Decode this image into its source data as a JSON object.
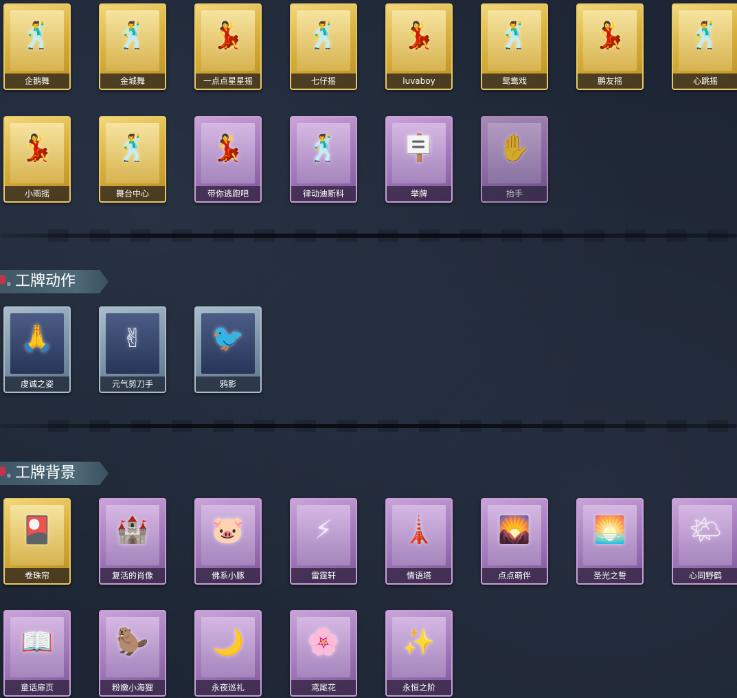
{
  "dance_row1": [
    {
      "label": "企鹅舞",
      "rarity": "gold",
      "icon": "dancing-figure-icon"
    },
    {
      "label": "金城舞",
      "rarity": "gold",
      "icon": "dancing-figure-icon"
    },
    {
      "label": "一点点星星摇",
      "rarity": "gold",
      "icon": "dancing-figure-icon"
    },
    {
      "label": "七仔摇",
      "rarity": "gold",
      "icon": "dancing-figure-icon"
    },
    {
      "label": "luvaboy",
      "rarity": "gold",
      "icon": "dancing-figure-icon"
    },
    {
      "label": "鸳鸯戏",
      "rarity": "gold",
      "icon": "dancing-figure-icon"
    },
    {
      "label": "鹏友摇",
      "rarity": "gold",
      "icon": "dancing-figure-icon"
    },
    {
      "label": "心跳摇",
      "rarity": "gold",
      "icon": "dancing-figure-icon"
    }
  ],
  "dance_row2": [
    {
      "label": "小雨摇",
      "rarity": "gold",
      "icon": "dancing-figure-icon"
    },
    {
      "label": "舞台中心",
      "rarity": "gold",
      "icon": "dancing-figure-icon"
    },
    {
      "label": "带你逃跑吧",
      "rarity": "purple",
      "icon": "dancing-figure-icon"
    },
    {
      "label": "律动迪斯科",
      "rarity": "purple",
      "icon": "dancing-figure-icon"
    },
    {
      "label": "举牌",
      "rarity": "purple",
      "icon": "sign-holder-icon"
    },
    {
      "label": "抬手",
      "rarity": "purple",
      "icon": "hand-raise-icon"
    }
  ],
  "badge_actions": {
    "title": "工牌动作",
    "items": [
      {
        "label": "虔诚之姿",
        "rarity": "blue",
        "icon": "silhouette-pose-icon"
      },
      {
        "label": "元气剪刀手",
        "rarity": "blue",
        "icon": "silhouette-pose-icon"
      },
      {
        "label": "鸦影",
        "rarity": "blue",
        "icon": "silhouette-pose-icon"
      }
    ]
  },
  "badge_backgrounds": {
    "title": "工牌背景",
    "row1": [
      {
        "label": "卷珠帘",
        "rarity": "gold",
        "icon": "background-card-icon"
      },
      {
        "label": "复活的肖像",
        "rarity": "purple",
        "icon": "background-card-icon"
      },
      {
        "label": "佛系小豚",
        "rarity": "purple",
        "icon": "background-card-icon"
      },
      {
        "label": "雷霆轩",
        "rarity": "purple",
        "icon": "background-card-icon"
      },
      {
        "label": "情语塔",
        "rarity": "purple",
        "icon": "background-card-icon"
      },
      {
        "label": "点点萌伴",
        "rarity": "purple",
        "icon": "background-card-icon"
      },
      {
        "label": "圣光之誓",
        "rarity": "purple",
        "icon": "background-card-icon"
      },
      {
        "label": "心同野鹤",
        "rarity": "purple",
        "icon": "background-card-icon"
      }
    ],
    "row2": [
      {
        "label": "童话扉页",
        "rarity": "purple",
        "icon": "background-card-icon"
      },
      {
        "label": "粉嫩小海狸",
        "rarity": "purple",
        "icon": "background-card-icon"
      },
      {
        "label": "永夜巡礼",
        "rarity": "purple",
        "icon": "background-card-icon"
      },
      {
        "label": "鸢尾花",
        "rarity": "purple",
        "icon": "background-card-icon"
      },
      {
        "label": "永恒之阶",
        "rarity": "purple",
        "icon": "background-card-icon"
      }
    ]
  }
}
